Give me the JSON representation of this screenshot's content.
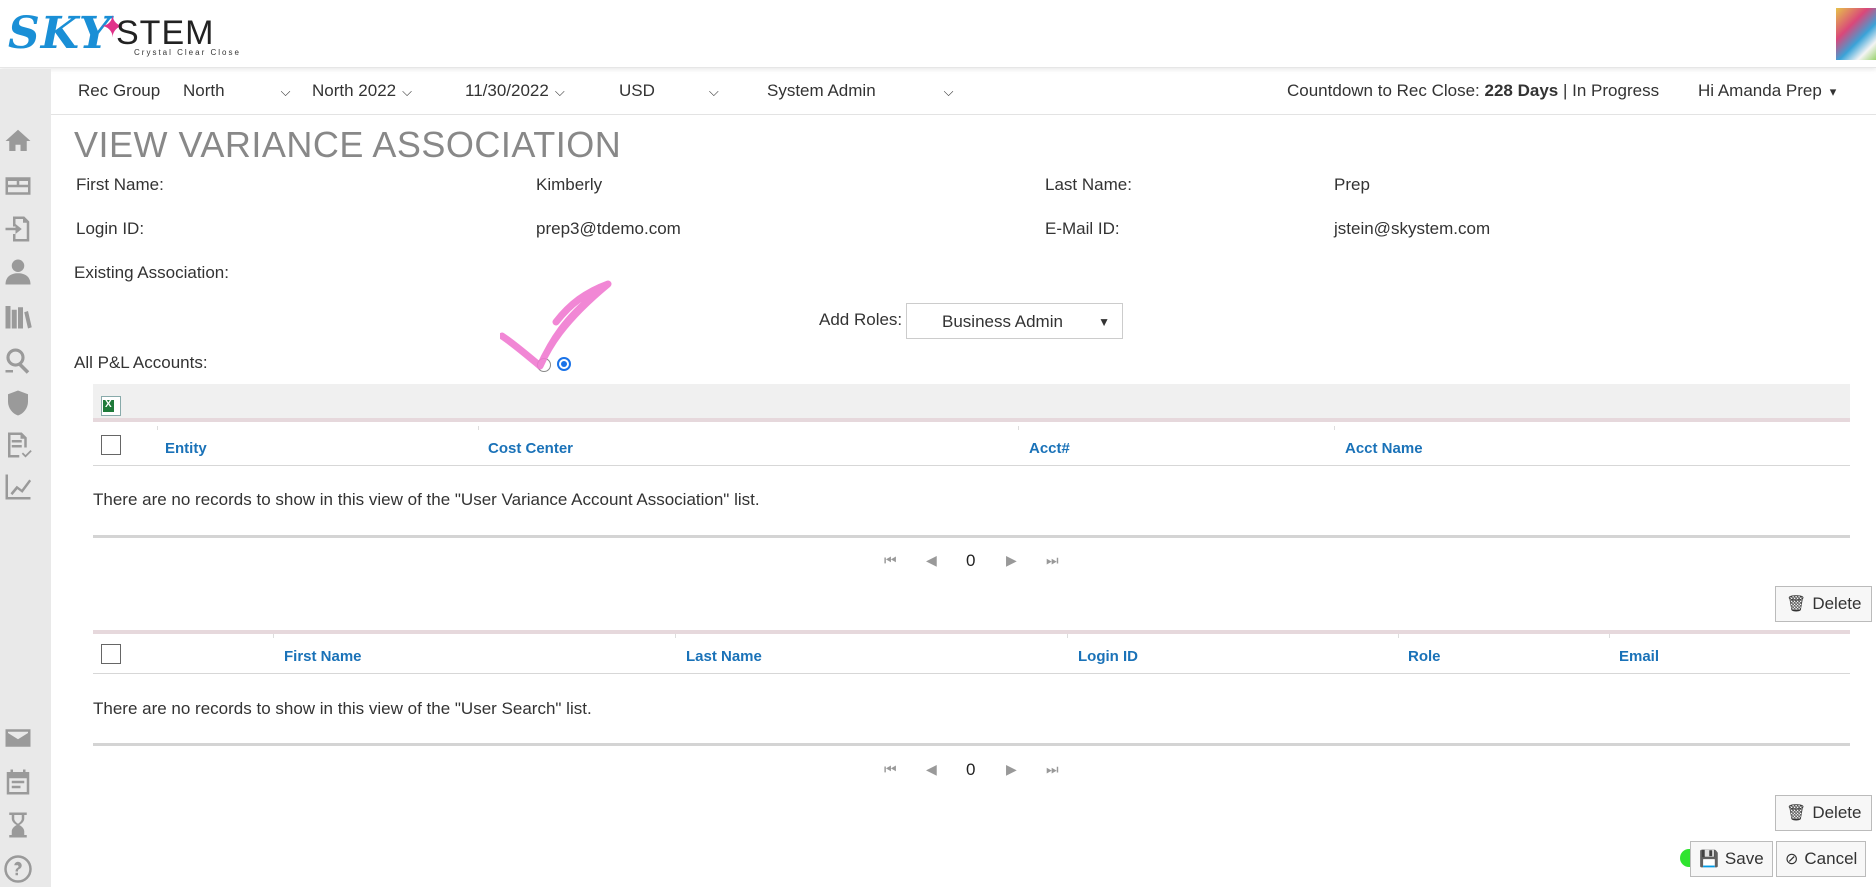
{
  "header": {
    "logo_sky": "SKY",
    "logo_stem": "STEM",
    "logo_tagline": "Crystal Clear Close"
  },
  "filters": {
    "rec_group_label": "Rec Group",
    "region": "North",
    "period": "North 2022",
    "date": "11/30/2022",
    "currency": "USD",
    "role": "System Admin",
    "countdown_label": "Countdown to Rec Close:",
    "countdown_days": "228 Days",
    "separator": "|",
    "status": "In Progress",
    "greeting": "Hi Amanda Prep"
  },
  "page": {
    "title": "VIEW VARIANCE ASSOCIATION"
  },
  "user_info": {
    "first_name_label": "First Name:",
    "first_name": "Kimberly",
    "last_name_label": "Last Name:",
    "last_name": "Prep",
    "login_label": "Login ID:",
    "login": "prep3@tdemo.com",
    "email_label": "E-Mail ID:",
    "email": "jstein@skystem.com",
    "existing_label": "Existing Association:",
    "add_roles_label": "Add Roles:",
    "add_roles_value": "Business Admin",
    "all_pl_label": "All P&L Accounts:"
  },
  "account_grid": {
    "columns": [
      "Entity",
      "Cost Center",
      "Acct#",
      "Acct Name"
    ],
    "empty_message": "There are no records to show in this view of the \"User Variance Account Association\" list.",
    "page_count": "0"
  },
  "user_grid": {
    "columns": [
      "First Name",
      "Last Name",
      "Login ID",
      "Role",
      "Email"
    ],
    "empty_message": "There are no records to show in this view of the \"User Search\" list.",
    "page_count": "0"
  },
  "buttons": {
    "delete": "Delete",
    "save": "Save",
    "cancel": "Cancel"
  },
  "colors": {
    "link_blue": "#1a72b8",
    "brand_blue": "#1a8fd6",
    "brand_pink": "#e0338a",
    "annotation_pink": "#f07ad0",
    "annotation_green": "#24e324"
  }
}
